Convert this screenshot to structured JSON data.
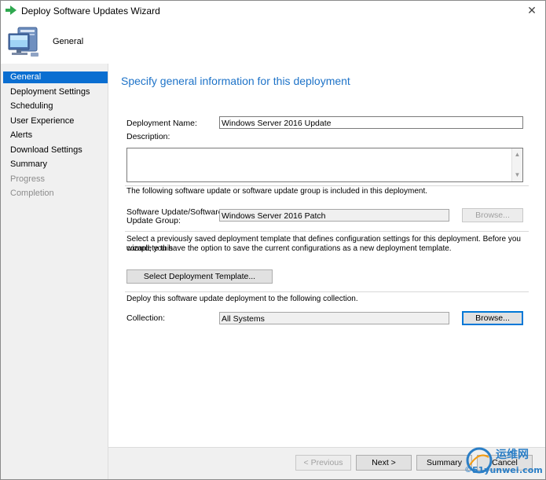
{
  "window": {
    "title": "Deploy Software Updates Wizard",
    "close_glyph": "✕"
  },
  "header": {
    "title": "General"
  },
  "nav": {
    "items": [
      {
        "label": "General",
        "state": "active"
      },
      {
        "label": "Deployment Settings",
        "state": "normal"
      },
      {
        "label": "Scheduling",
        "state": "normal"
      },
      {
        "label": "User Experience",
        "state": "normal"
      },
      {
        "label": "Alerts",
        "state": "normal"
      },
      {
        "label": "Download Settings",
        "state": "normal"
      },
      {
        "label": "Summary",
        "state": "normal"
      },
      {
        "label": "Progress",
        "state": "disabled"
      },
      {
        "label": "Completion",
        "state": "disabled"
      }
    ]
  },
  "main": {
    "heading": "Specify general information for this deployment",
    "deployment_name": {
      "label": "Deployment Name:",
      "value": "Windows Server 2016 Update"
    },
    "description": {
      "label": "Description:",
      "value": ""
    },
    "update_group_info": "The following software update or software update group is included in this deployment.",
    "update_group": {
      "label_line1": "Software Update/Software",
      "label_line2": "Update Group:",
      "value": "Windows Server 2016 Patch",
      "browse_label": "Browse..."
    },
    "template_info_line1": "Select a previously saved deployment template that defines configuration settings for this deployment. Before you complete this",
    "template_info_line2": "wizard, you have the option to save the current configurations as a new deployment template.",
    "template_button_label": "Select Deployment Template...",
    "collection_info": "Deploy this software update deployment to the following collection.",
    "collection": {
      "label": "Collection:",
      "value": "All Systems",
      "browse_label": "Browse..."
    }
  },
  "footer": {
    "previous_label": "< Previous",
    "next_label": "Next >",
    "summary_label": "Summary",
    "cancel_label": "Cancel"
  },
  "watermark": {
    "cn_text": "运维网",
    "brand_text": "51yunwei",
    "domain_text": ".com",
    "prefix": "©"
  },
  "colors": {
    "accent": "#0a6ed1",
    "heading": "#1e73c8",
    "nav_bg": "#f0f0f0"
  },
  "icons": {
    "title": "green-arrow-icon",
    "header": "computer-icon"
  }
}
